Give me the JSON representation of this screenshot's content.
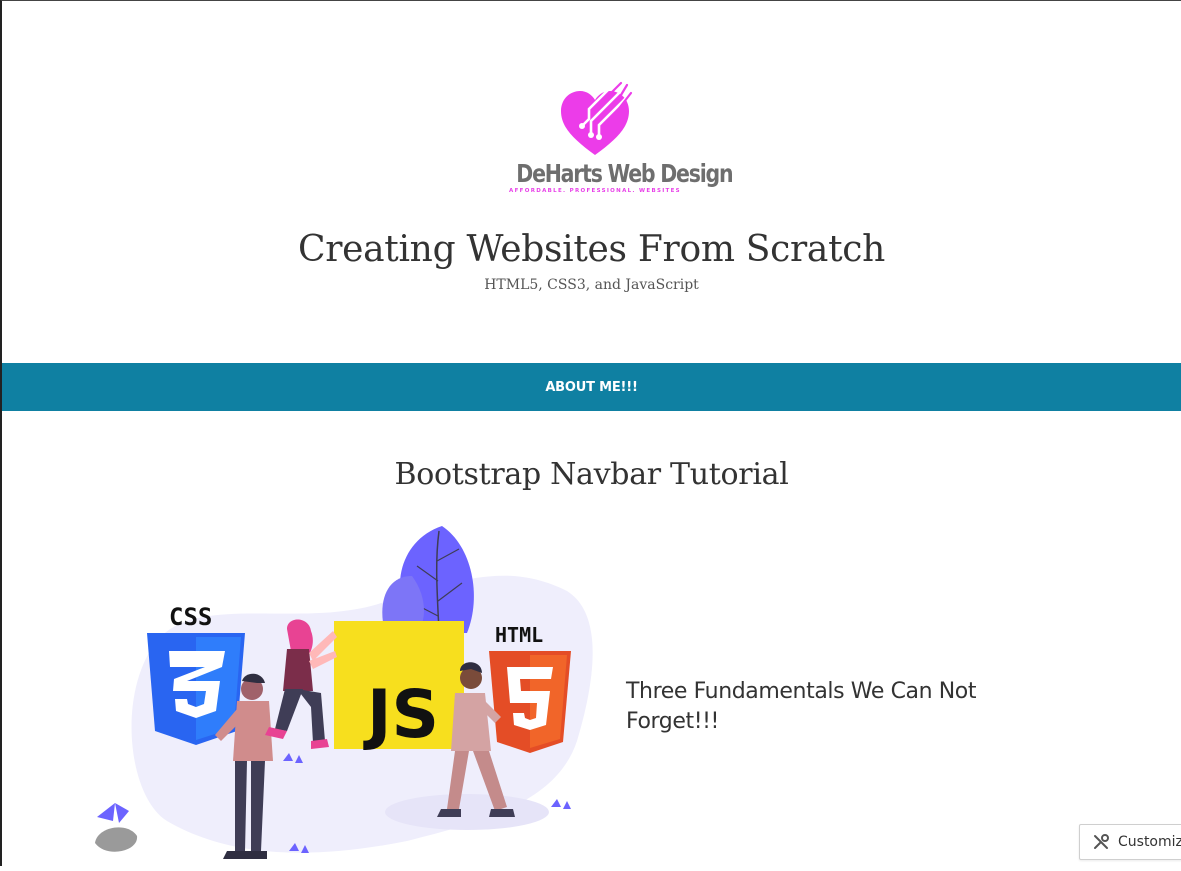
{
  "header": {
    "brand_name": "DeHarts Web Design",
    "brand_tagline": "AFFORDABLE. PROFESSIONAL. WEBSITES",
    "site_title": "Creating Websites From Scratch",
    "site_description": "HTML5, CSS3, and JavaScript"
  },
  "navbar": {
    "items": [
      {
        "label": "ABOUT ME!!!"
      }
    ]
  },
  "post": {
    "title": "Bootstrap Navbar Tutorial",
    "hero_text": "Three Fundamentals We Can Not Forget!!!",
    "illustration_labels": {
      "css": "CSS",
      "html": "HTML",
      "js": "JS"
    }
  },
  "customize_button": {
    "label": "Customiz",
    "icon": "tools-icon"
  },
  "colors": {
    "navbar": "#0f80a2",
    "brand_pink": "#ec3ce9",
    "css_blue": "#2965f1",
    "html_orange": "#e44d26",
    "js_yellow": "#f7df1e",
    "leaf_purple": "#6c63ff"
  }
}
